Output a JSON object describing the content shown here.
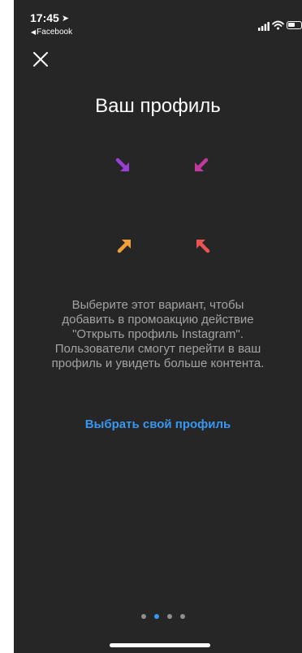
{
  "status_bar": {
    "time": "17:45",
    "back_app": "Facebook",
    "location_icon": "location-arrow-icon",
    "signal_icon": "signal-bars-icon",
    "wifi_icon": "wifi-icon",
    "battery_icon": "battery-icon"
  },
  "header": {
    "close_icon": "close-icon"
  },
  "main": {
    "title": "Ваш профиль",
    "arrows": [
      {
        "name": "arrow-down-right-icon",
        "color": "#9b3ed6"
      },
      {
        "name": "arrow-down-left-icon",
        "color": "#c0399d"
      },
      {
        "name": "arrow-up-right-icon",
        "color": "#f0a03a"
      },
      {
        "name": "arrow-up-left-icon",
        "color": "#e95353"
      }
    ],
    "description_lines": [
      "Выберите этот вариант, чтобы",
      "добавить в промоакцию действие",
      "\"Открыть профиль Instagram\".",
      "Пользователи смогут перейти в ваш",
      "профиль и увидеть больше контента."
    ],
    "action_label": "Выбрать свой профиль"
  },
  "pagination": {
    "current_page": 2,
    "total_pages": 4,
    "active_color": "#3897f0",
    "inactive_color": "#8e8e8e"
  },
  "colors": {
    "background": "#262626",
    "text_primary": "#ffffff",
    "text_secondary": "#a3a3a3",
    "accent": "#3897f0"
  }
}
